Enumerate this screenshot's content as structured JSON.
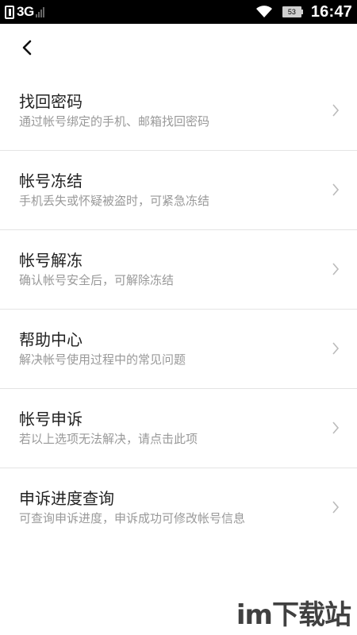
{
  "status_bar": {
    "network": "3G",
    "battery_level": "53",
    "time": "16:47"
  },
  "nav": {
    "back_icon": "chevron-left-icon"
  },
  "menu": [
    {
      "title": "找回密码",
      "desc": "通过帐号绑定的手机、邮箱找回密码"
    },
    {
      "title": "帐号冻结",
      "desc": "手机丢失或怀疑被盗时，可紧急冻结"
    },
    {
      "title": "帐号解冻",
      "desc": "确认帐号安全后，可解除冻结"
    },
    {
      "title": "帮助中心",
      "desc": "解决帐号使用过程中的常见问题"
    },
    {
      "title": "帐号申诉",
      "desc": "若以上选项无法解决，请点击此项"
    },
    {
      "title": "申诉进度查询",
      "desc": "可查询申诉进度，申诉成功可修改帐号信息"
    }
  ],
  "watermark": "im下载站",
  "colors": {
    "status_bar_bg": "#000000",
    "title_text": "#222222",
    "desc_text": "#999999",
    "divider": "#e4e4e4",
    "chevron": "#bbbbbb"
  }
}
